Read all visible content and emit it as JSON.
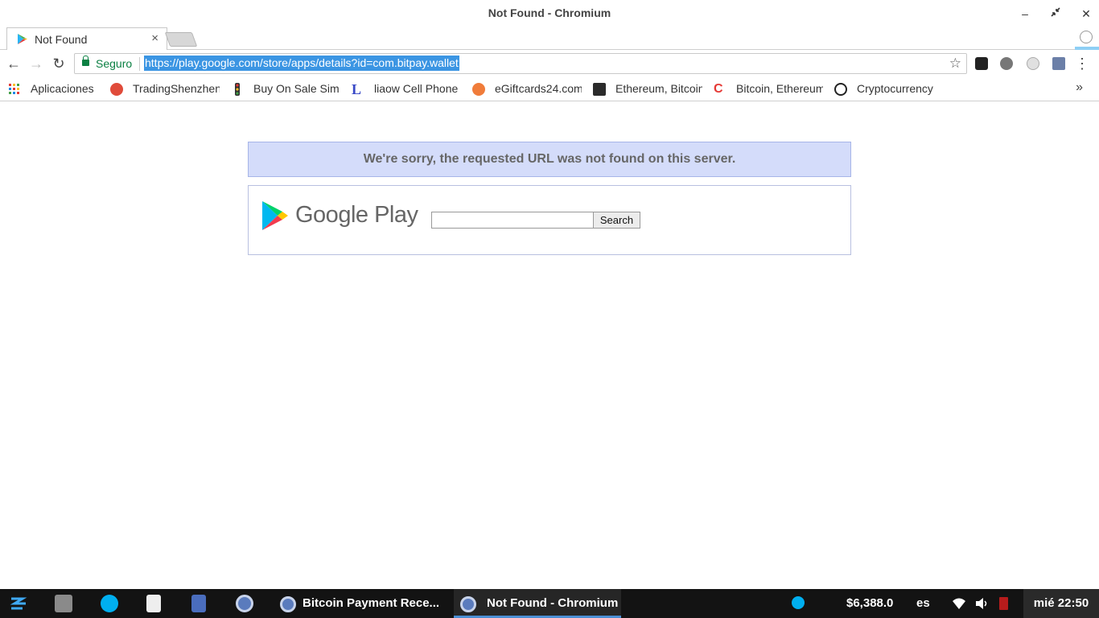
{
  "window": {
    "title": "Not Found - Chromium"
  },
  "tabs": [
    {
      "label": "Not Found",
      "close": "×"
    }
  ],
  "toolbar": {
    "secure_label": "Seguro",
    "url": "https://play.google.com/store/apps/details?id=com.bitpay.wallet",
    "star": "☆",
    "menu": "⋮"
  },
  "bookmarks": {
    "items": [
      {
        "label": "Aplicaciones",
        "icon": "apps-grid-icon"
      },
      {
        "label": "TradingShenzhen",
        "icon": "tradingshenzhen-icon"
      },
      {
        "label": "Buy On Sale Sim",
        "icon": "traffic-light-icon"
      },
      {
        "label": "liaow Cell Phone",
        "icon": "liaow-icon"
      },
      {
        "label": "eGiftcards24.com",
        "icon": "egiftcards-icon"
      },
      {
        "label": "Ethereum, Bitcoin",
        "icon": "ethereum-icon"
      },
      {
        "label": "Bitcoin, Ethereum",
        "icon": "coin-c-icon"
      },
      {
        "label": "Cryptocurrency",
        "icon": "coinmarketcap-icon"
      }
    ],
    "more": "»"
  },
  "page": {
    "notice": "We're sorry, the requested URL was not found on this server.",
    "logo_text": "Google Play",
    "search_value": "",
    "search_button": "Search"
  },
  "taskbar": {
    "tasks": [
      {
        "label": "Bitcoin Payment Rece..."
      },
      {
        "label": "Not Found - Chromium"
      }
    ],
    "price": "$6,388.0",
    "language": "es",
    "clock": "mié 22:50"
  },
  "colors": {
    "accent": "#3b95e3",
    "secure": "#0b8043",
    "notice_bg": "#d4dcfa"
  }
}
